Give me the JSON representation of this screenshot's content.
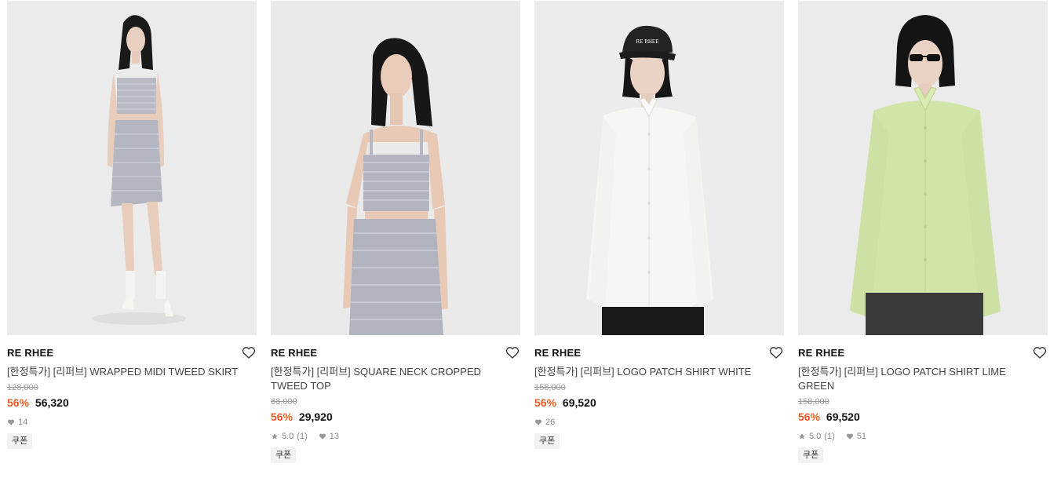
{
  "products": [
    {
      "brand": "RE RHEE",
      "name": "[한정특가] [리퍼브] WRAPPED MIDI TWEED SKIRT",
      "original_price": "128,000",
      "discount": "56%",
      "sale_price": "56,320",
      "rating": "",
      "review_count": "",
      "likes": "14",
      "coupon": "쿠폰"
    },
    {
      "brand": "RE RHEE",
      "name": "[한정특가] [리퍼브] SQUARE NECK CROPPED TWEED TOP",
      "original_price": "68,000",
      "discount": "56%",
      "sale_price": "29,920",
      "rating": "5.0",
      "review_count": "(1)",
      "likes": "13",
      "coupon": "쿠폰"
    },
    {
      "brand": "RE RHEE",
      "name": "[한정특가] [리퍼브] LOGO PATCH SHIRT WHITE",
      "original_price": "158,000",
      "discount": "56%",
      "sale_price": "69,520",
      "rating": "",
      "review_count": "",
      "likes": "26",
      "coupon": "쿠폰"
    },
    {
      "brand": "RE RHEE",
      "name": "[한정특가] [리퍼브] LOGO PATCH SHIRT LIME GREEN",
      "original_price": "158,000",
      "discount": "56%",
      "sale_price": "69,520",
      "rating": "5.0",
      "review_count": "(1)",
      "likes": "51",
      "coupon": "쿠폰"
    }
  ],
  "cap_text": "RE RHEE",
  "colors": {
    "discount": "#f05a24",
    "background": "#ebebeb"
  },
  "icons": {
    "wishlist": "heart-outline-icon",
    "likes": "heart-filled-icon",
    "rating": "star-icon"
  }
}
